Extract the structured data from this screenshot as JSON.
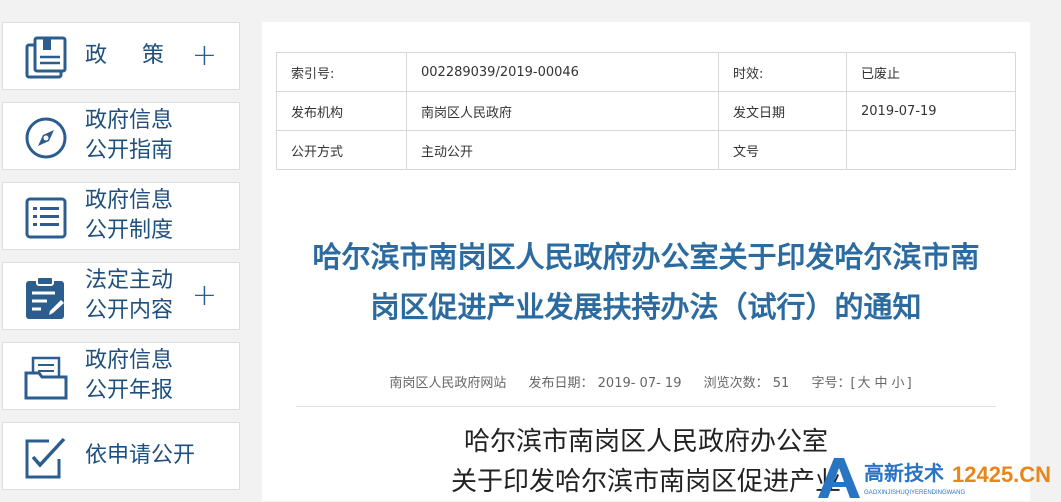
{
  "sidebar": {
    "items": [
      {
        "label": "政 策",
        "icon": "policy-book-icon",
        "expandable": true
      },
      {
        "label": "政府信息\n公开指南",
        "icon": "compass-icon",
        "expandable": false
      },
      {
        "label": "政府信息\n公开制度",
        "icon": "list-document-icon",
        "expandable": false
      },
      {
        "label": "法定主动\n公开内容",
        "icon": "clipboard-edit-icon",
        "expandable": true
      },
      {
        "label": "政府信息\n公开年报",
        "icon": "folder-report-icon",
        "expandable": false
      },
      {
        "label": "依申请公开",
        "icon": "checkbox-edit-icon",
        "expandable": false
      }
    ],
    "plus_symbol": "+"
  },
  "meta": {
    "index_label": "索引号:",
    "index_value": "002289039/2019-00046",
    "validity_label": "时效:",
    "validity_value": "已废止",
    "issuer_label": "发布机构",
    "issuer_value": "南岗区人民政府",
    "issue_date_label": "发文日期",
    "issue_date_value": "2019-07-19",
    "disclosure_label": "公开方式",
    "disclosure_value": "主动公开",
    "doc_no_label": "文号",
    "doc_no_value": ""
  },
  "article": {
    "title_line1": "哈尔滨市南岗区人民政府办公室关于印发哈尔滨市南",
    "title_line2": "岗区促进产业发展扶持办法（试行）的通知",
    "source": "南岗区人民政府网站",
    "publish_date": "发布日期： 2019- 07- 19",
    "views": "浏览次数： 51",
    "font_size_label": "字号：[",
    "font_large": "大",
    "font_medium": "中",
    "font_small": "小",
    "font_close": "]",
    "body_heading": "哈尔滨市南岗区人民政府办公室\n关于印发哈尔滨市南岗区促进产业"
  },
  "watermark": {
    "brand": "高新技术",
    "domain": "12425.CN",
    "pinyin": "GAOXINJISHUQIYERENDINGWANG"
  },
  "colors": {
    "accent_blue": "#2c6ba0",
    "sidebar_text": "#1f4f7f",
    "icon_blue": "#2c5d8f"
  }
}
